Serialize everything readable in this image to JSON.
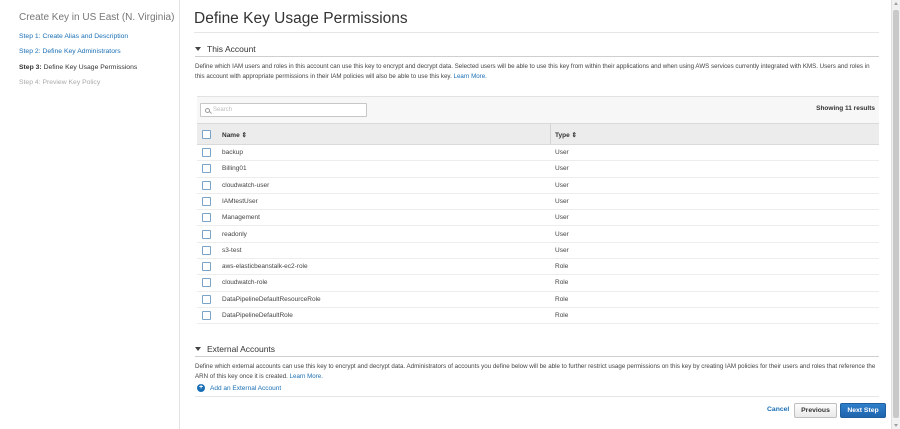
{
  "sidebar": {
    "title": "Create Key in US East (N. Virginia)",
    "steps": [
      {
        "num": "Step 1:",
        "label": "Create Alias and Description"
      },
      {
        "num": "Step 2:",
        "label": "Define Key Administrators"
      },
      {
        "num": "Step 3:",
        "label": "Define Key Usage Permissions"
      },
      {
        "num": "Step 4:",
        "label": "Preview Key Policy"
      }
    ]
  },
  "main": {
    "title": "Define Key Usage Permissions",
    "this_account": {
      "heading": "This Account",
      "description": "Define which IAM users and roles in this account can use this key to encrypt and decrypt data. Selected users will be able to use this key from within their applications and when using AWS services currently integrated with KMS. Users and roles in this account with appropriate permissions in their IAM policies will also be able to use this key.",
      "learn_more": "Learn More."
    },
    "table": {
      "search_placeholder": "Search",
      "results_text": "Showing 11 results",
      "columns": {
        "name": "Name ⇕",
        "type": "Type ⇕"
      },
      "rows": [
        {
          "name": "backup",
          "type": "User"
        },
        {
          "name": "Billing01",
          "type": "User"
        },
        {
          "name": "cloudwatch-user",
          "type": "User"
        },
        {
          "name": "IAMtestUser",
          "type": "User"
        },
        {
          "name": "Management",
          "type": "User"
        },
        {
          "name": "readonly",
          "type": "User"
        },
        {
          "name": "s3-test",
          "type": "User"
        },
        {
          "name": "aws-elasticbeanstalk-ec2-role",
          "type": "Role"
        },
        {
          "name": "cloudwatch-role",
          "type": "Role"
        },
        {
          "name": "DataPipelineDefaultResourceRole",
          "type": "Role"
        },
        {
          "name": "DataPipelineDefaultRole",
          "type": "Role"
        }
      ]
    },
    "external_accounts": {
      "heading": "External Accounts",
      "description": "Define which external accounts can use this key to encrypt and decrypt data. Administrators of accounts you define below will be able to further restrict usage permissions on this key by creating IAM policies for their users and roles that reference the ARN of this key once it is created.",
      "learn_more": "Learn More.",
      "add_label": "Add an External Account"
    },
    "footer": {
      "cancel": "Cancel",
      "previous": "Previous",
      "next": "Next Step"
    }
  },
  "colors": {
    "link": "#1a6fb5",
    "primary_button": "#2a74c0"
  }
}
